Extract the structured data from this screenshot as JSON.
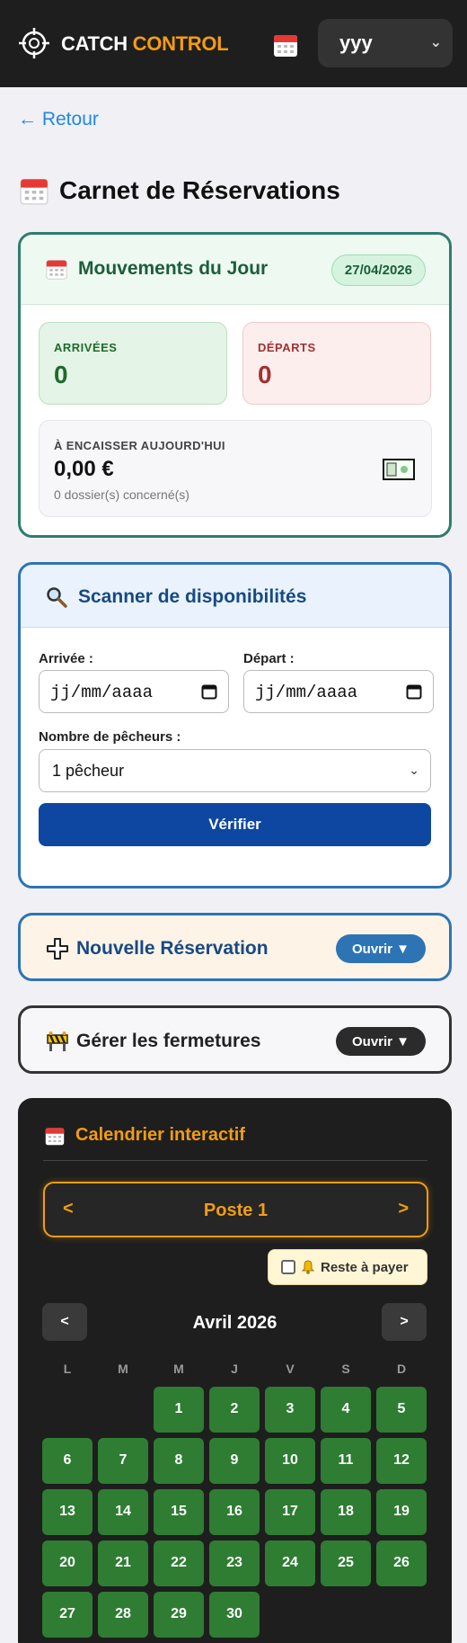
{
  "topbar": {
    "brand_part1": "CATCH ",
    "brand_part2": "CONTROL",
    "user_selected": "yyy"
  },
  "nav": {
    "back_label": "← Retour"
  },
  "page": {
    "title": "Carnet de Réservations"
  },
  "daily": {
    "title": "Mouvements du Jour",
    "date": "27/04/2026",
    "arrivals_label": "ARRIVÉES",
    "arrivals_value": "0",
    "departures_label": "DÉPARTS",
    "departures_value": "0",
    "to_collect_label": "À ENCAISSER AUJOURD'HUI",
    "to_collect_value": "0,00 €",
    "to_collect_sub": "0 dossier(s) concerné(s)"
  },
  "scanner": {
    "title": "Scanner de disponibilités",
    "arrival_label": "Arrivée :",
    "arrival_placeholder": "jj/mm/aaaa",
    "departure_label": "Départ :",
    "departure_placeholder": "jj/mm/aaaa",
    "anglers_label": "Nombre de pêcheurs :",
    "anglers_selected": "1 pêcheur",
    "verify_label": "Vérifier"
  },
  "new_booking": {
    "title": "Nouvelle Réservation",
    "open_label": "Ouvrir ▼"
  },
  "closures": {
    "title": "Gérer les fermetures",
    "open_label": "Ouvrir ▼"
  },
  "calendar": {
    "title": "Calendrier interactif",
    "poste_prev": "<",
    "poste_name": "Poste 1",
    "poste_next": ">",
    "due_toggle_label": "Reste à payer",
    "month_prev": "<",
    "month_label": "Avril 2026",
    "month_next": ">",
    "weekdays": [
      "L",
      "M",
      "M",
      "J",
      "V",
      "S",
      "D"
    ],
    "days": [
      "1",
      "2",
      "3",
      "4",
      "5",
      "6",
      "7",
      "8",
      "9",
      "10",
      "11",
      "12",
      "13",
      "14",
      "15",
      "16",
      "17",
      "18",
      "19",
      "20",
      "21",
      "22",
      "23",
      "24",
      "25",
      "26",
      "27",
      "28",
      "29",
      "30"
    ],
    "first_weekday_index": 2
  },
  "colors": {
    "accent": "#f39c12",
    "primary": "#0d47a1",
    "available_day": "#2e7d32",
    "dark_bg": "#1e1e1e"
  }
}
